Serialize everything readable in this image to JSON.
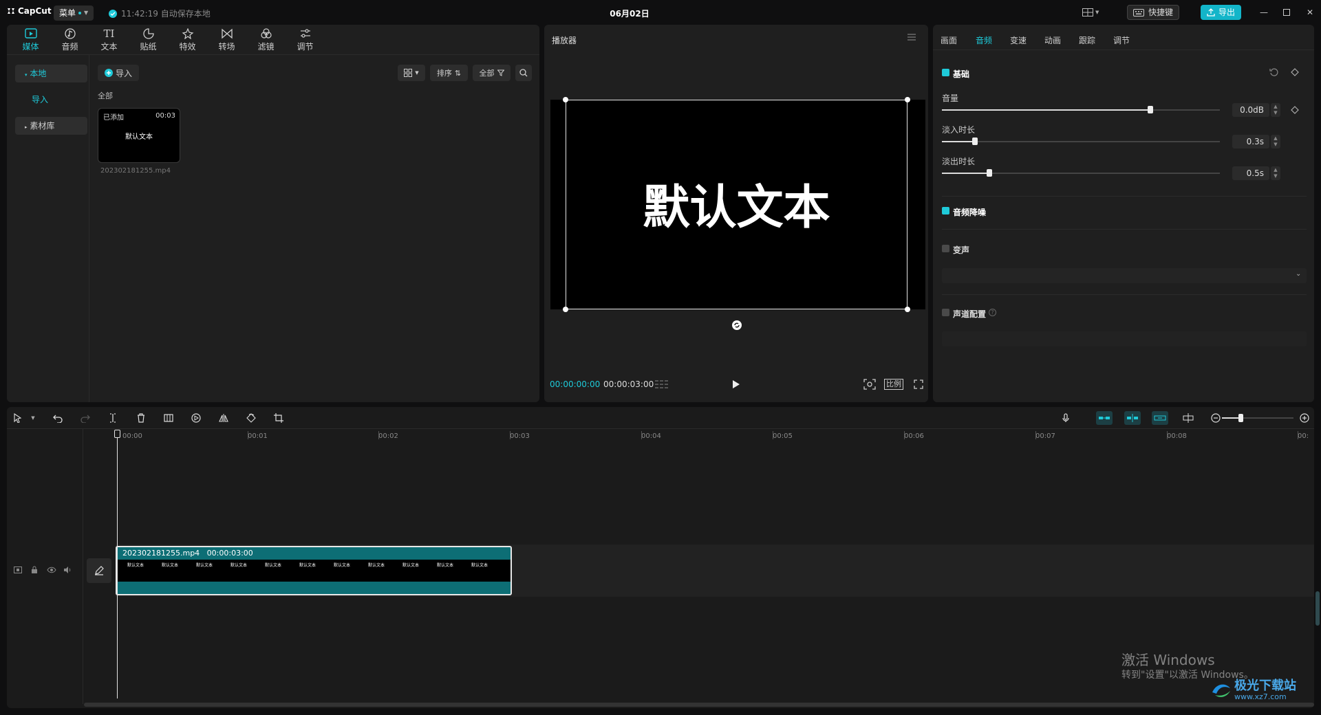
{
  "app": {
    "logo": "CapCut",
    "menu_label": "菜单",
    "autosave_text": "11:42:19 自动保存本地",
    "project_title": "06月02日",
    "shortcut_label": "快捷键",
    "export_label": "导出"
  },
  "media_tools": [
    {
      "label": "媒体",
      "icon": "media-icon"
    },
    {
      "label": "音频",
      "icon": "audio-icon"
    },
    {
      "label": "文本",
      "icon": "text-icon"
    },
    {
      "label": "贴纸",
      "icon": "sticker-icon"
    },
    {
      "label": "特效",
      "icon": "effects-icon"
    },
    {
      "label": "转场",
      "icon": "transition-icon"
    },
    {
      "label": "滤镜",
      "icon": "filter-icon"
    },
    {
      "label": "调节",
      "icon": "adjust-icon"
    }
  ],
  "sidebar": {
    "local": "本地",
    "import": "导入",
    "library": "素材库"
  },
  "media": {
    "import_button": "导入",
    "sort_label": "排序",
    "filter_label": "全部",
    "section_all": "全部",
    "item": {
      "added_badge": "已添加",
      "duration": "00:03",
      "thumb_text": "默认文本",
      "filename": "202302181255.mp4"
    }
  },
  "player": {
    "title": "播放器",
    "canvas_text": "默认文本",
    "current_time": "00:00:00:00",
    "total_time": "00:00:03:00",
    "ratio_label": "比例"
  },
  "properties": {
    "tabs": [
      "画面",
      "音频",
      "变速",
      "动画",
      "跟踪",
      "调节"
    ],
    "active_tab": "音频",
    "basic_label": "基础",
    "volume_label": "音量",
    "volume_value": "0.0dB",
    "volume_level": 0.75,
    "fadein_label": "淡入时长",
    "fadein_value": "0.3s",
    "fadein_level": 0.12,
    "fadeout_label": "淡出时长",
    "fadeout_value": "0.5s",
    "fadeout_level": 0.17,
    "denoise_label": "音频降噪",
    "voice_change_label": "变声",
    "channel_label": "声道配置"
  },
  "timeline": {
    "ruler": [
      "00:00",
      "00:01",
      "00:02",
      "00:03",
      "00:04",
      "00:05",
      "00:06",
      "00:07",
      "00:08",
      "00:"
    ],
    "clip_label": "202302181255.mp4   00:00:03:00",
    "clip_frame_text": "默认文本"
  },
  "watermark": {
    "line1": "激活 Windows",
    "line2": "转到\"设置\"以激活 Windows。",
    "site_text": "极光下载站",
    "site_url": "www.xz7.com"
  },
  "colors": {
    "accent": "#1fcad9",
    "export": "#13b5c9",
    "clip": "#0d6e75"
  }
}
